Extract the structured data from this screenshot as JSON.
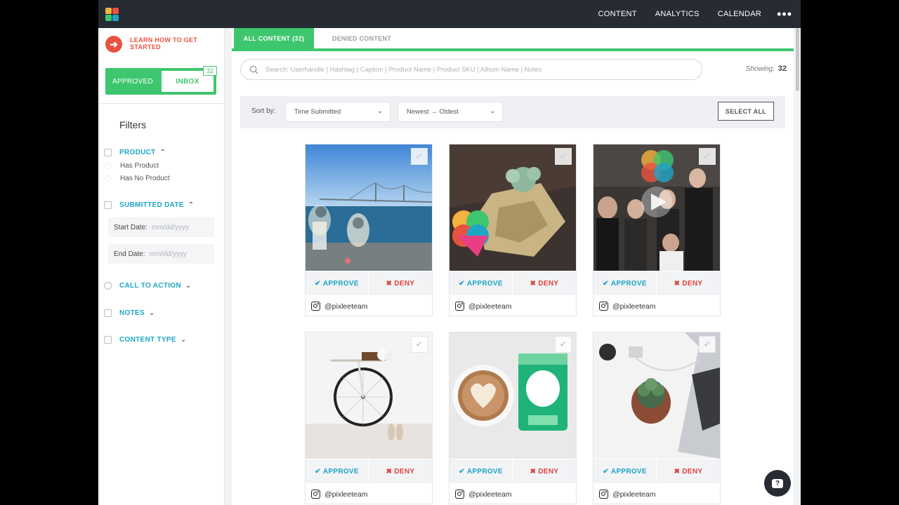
{
  "topnav": {
    "items": [
      "CONTENT",
      "ANALYTICS",
      "CALENDAR"
    ],
    "more": "•••"
  },
  "sidebar": {
    "learn": "LEARN HOW TO GET STARTED",
    "toggle": {
      "approved": "APPROVED",
      "inbox": "INBOX",
      "badge": "32"
    },
    "filters_title": "Filters",
    "product": {
      "label": "PRODUCT",
      "options": [
        "Has Product",
        "Has No Product"
      ]
    },
    "submitted_date": {
      "label": "SUBMITTED DATE",
      "start_label": "Start Date:",
      "start_placeholder": "mm/dd/yyyy",
      "end_label": "End Date:",
      "end_placeholder": "mm/dd/yyyy"
    },
    "call_to_action": "CALL TO ACTION",
    "notes": "NOTES",
    "content_type": "CONTENT TYPE"
  },
  "main": {
    "tabs": {
      "all": "ALL CONTENT (32)",
      "denied": "DENIED CONTENT"
    },
    "search_placeholder": "Search:   Userhandle  |  Hashtag  |  Caption  |  Product Name  |  Product SKU  |  Album Name  |  Notes",
    "showing_label": "Showing:",
    "showing_count": "32",
    "sort": {
      "label": "Sort by:",
      "field": "Time Submitted",
      "order": "Newest → Oldest",
      "select_all": "SELECT ALL"
    },
    "card_actions": {
      "approve": "APPROVE",
      "deny": "DENY"
    },
    "cards": [
      {
        "user": "@pixleeteam"
      },
      {
        "user": "@pixleeteam"
      },
      {
        "user": "@pixleeteam"
      },
      {
        "user": "@pixleeteam"
      },
      {
        "user": "@pixleeteam"
      },
      {
        "user": "@pixleeteam"
      }
    ]
  },
  "colors": {
    "accent_green": "#3ec66e",
    "link_blue": "#1ea6c7",
    "deny_red": "#e0413a",
    "learn_orange": "#e8533f",
    "topbar": "#272b33"
  },
  "icons": [
    "logo-icon",
    "arrow-right-icon",
    "search-icon",
    "chevron-down-icon",
    "checkmark-icon",
    "instagram-icon",
    "chat-icon"
  ]
}
